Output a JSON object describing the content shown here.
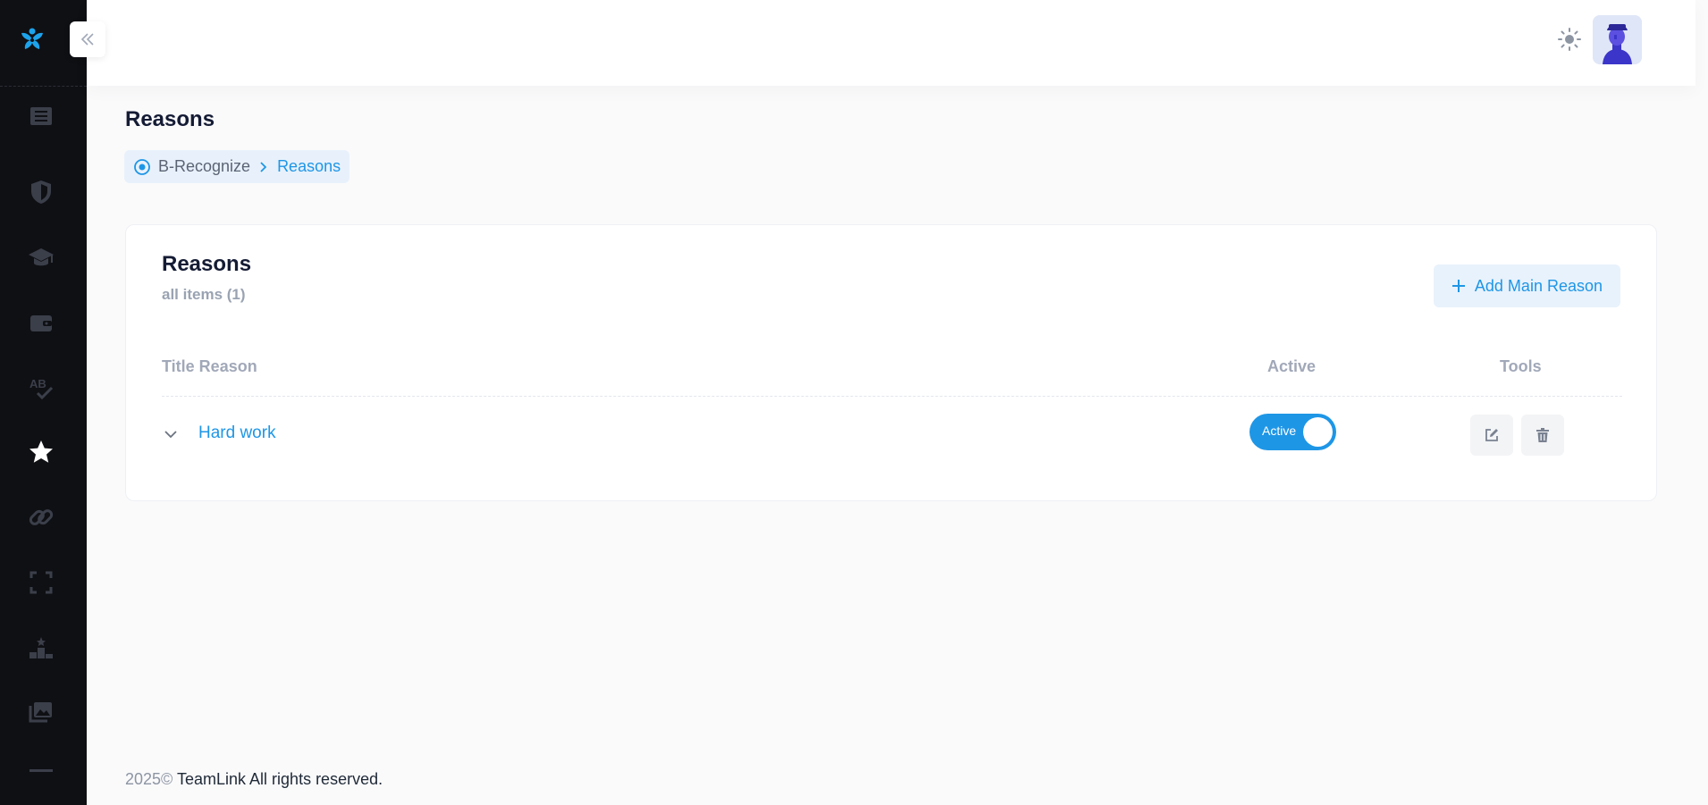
{
  "header": {
    "theme_icon": "sun-icon",
    "avatar_icon": "user-avatar"
  },
  "sidebar": {
    "logo_icon": "teamlink-logo",
    "items": [
      {
        "icon": "book-icon"
      },
      {
        "icon": "shield-icon"
      },
      {
        "icon": "graduation-cap-icon"
      },
      {
        "icon": "wallet-icon"
      },
      {
        "icon": "spellcheck-icon"
      },
      {
        "icon": "star-icon",
        "active": true
      },
      {
        "icon": "link-icon"
      },
      {
        "icon": "fullscreen-icon"
      },
      {
        "icon": "leaderboard-icon"
      },
      {
        "icon": "gallery-icon"
      },
      {
        "icon": "minus-icon"
      }
    ]
  },
  "page": {
    "title": "Reasons",
    "breadcrumb": {
      "home": "B-Recognize",
      "current": "Reasons"
    }
  },
  "card": {
    "title": "Reasons",
    "subtitle": "all items (1)",
    "add_button_label": "Add Main Reason",
    "columns": {
      "title": "Title Reason",
      "active": "Active",
      "tools": "Tools"
    },
    "rows": [
      {
        "title": "Hard work",
        "status_label": "Active",
        "active": true
      }
    ]
  },
  "footer": {
    "year": "2025©",
    "text": "TeamLink All rights reserved."
  },
  "colors": {
    "accent": "#1e96e6",
    "sidebar_bg": "#0f1014",
    "sidebar_icon": "#3b3f4a"
  }
}
